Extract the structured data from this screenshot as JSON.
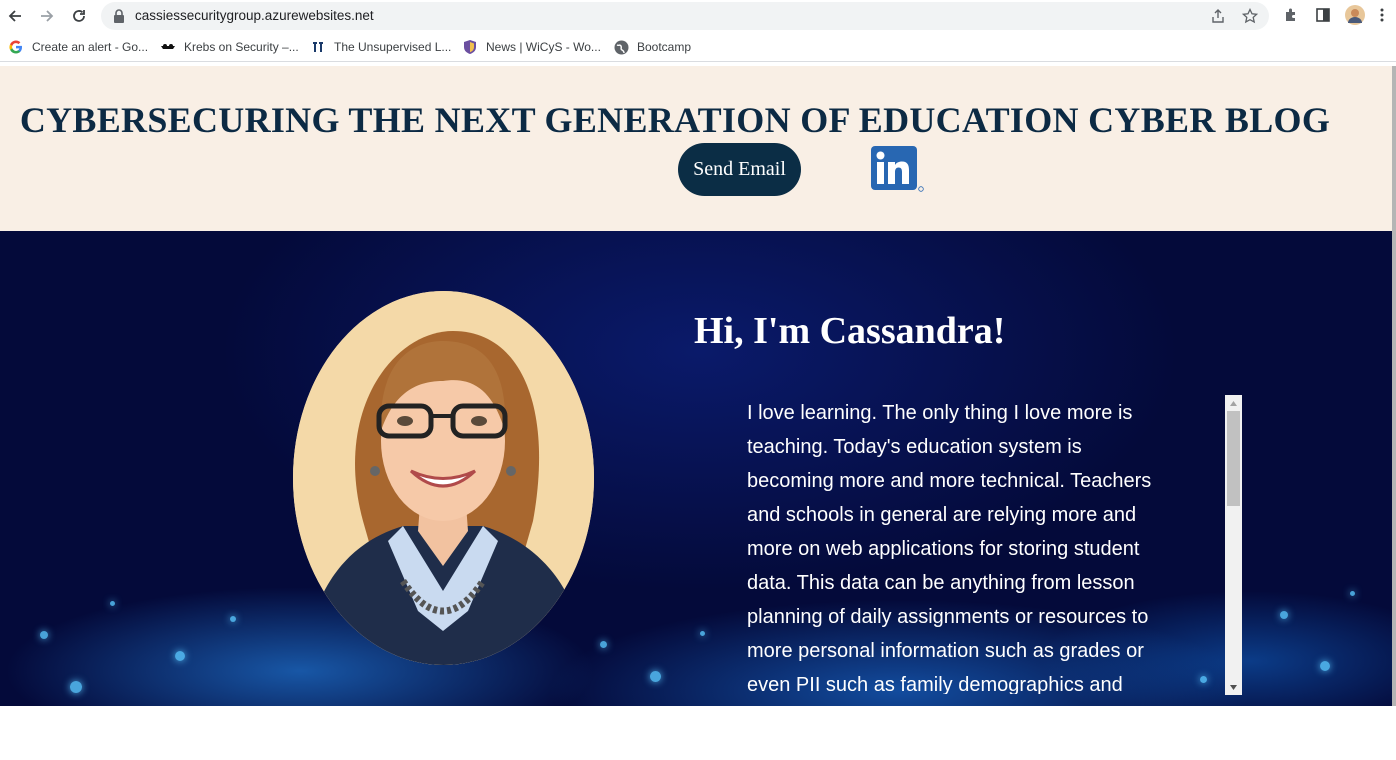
{
  "browser": {
    "url": "cassiessecuritygroup.azurewebsites.net",
    "bookmarks": [
      {
        "label": "Create an alert - Go...",
        "icon": "google-icon"
      },
      {
        "label": "Krebs on Security –...",
        "icon": "krebs-icon"
      },
      {
        "label": "The Unsupervised L...",
        "icon": "unsupervised-icon"
      },
      {
        "label": "News | WiCyS - Wo...",
        "icon": "wicys-icon"
      },
      {
        "label": "Bootcamp",
        "icon": "globe-icon"
      }
    ]
  },
  "header": {
    "title": "CYBERSECURING THE NEXT GENERATION OF EDUCATION CYBER BLOG",
    "email_button": "Send Email",
    "linkedin_label": "in"
  },
  "hero": {
    "heading": "Hi, I'm Cassandra!",
    "bio": "I love learning. The only thing I love more is teaching. Today's education system is becoming more and more technical. Teachers and schools in general are relying more and more on web applications for storing student data. This data can be anything from lesson planning of daily assignments or resources to more personal information such as grades or even PII such as family demographics and"
  },
  "colors": {
    "header_bg": "#f9efe5",
    "title_color": "#0c2a44",
    "button_bg": "#0b2d45",
    "hero_bg": "#040a3a",
    "linkedin_blue": "#2867b2"
  }
}
